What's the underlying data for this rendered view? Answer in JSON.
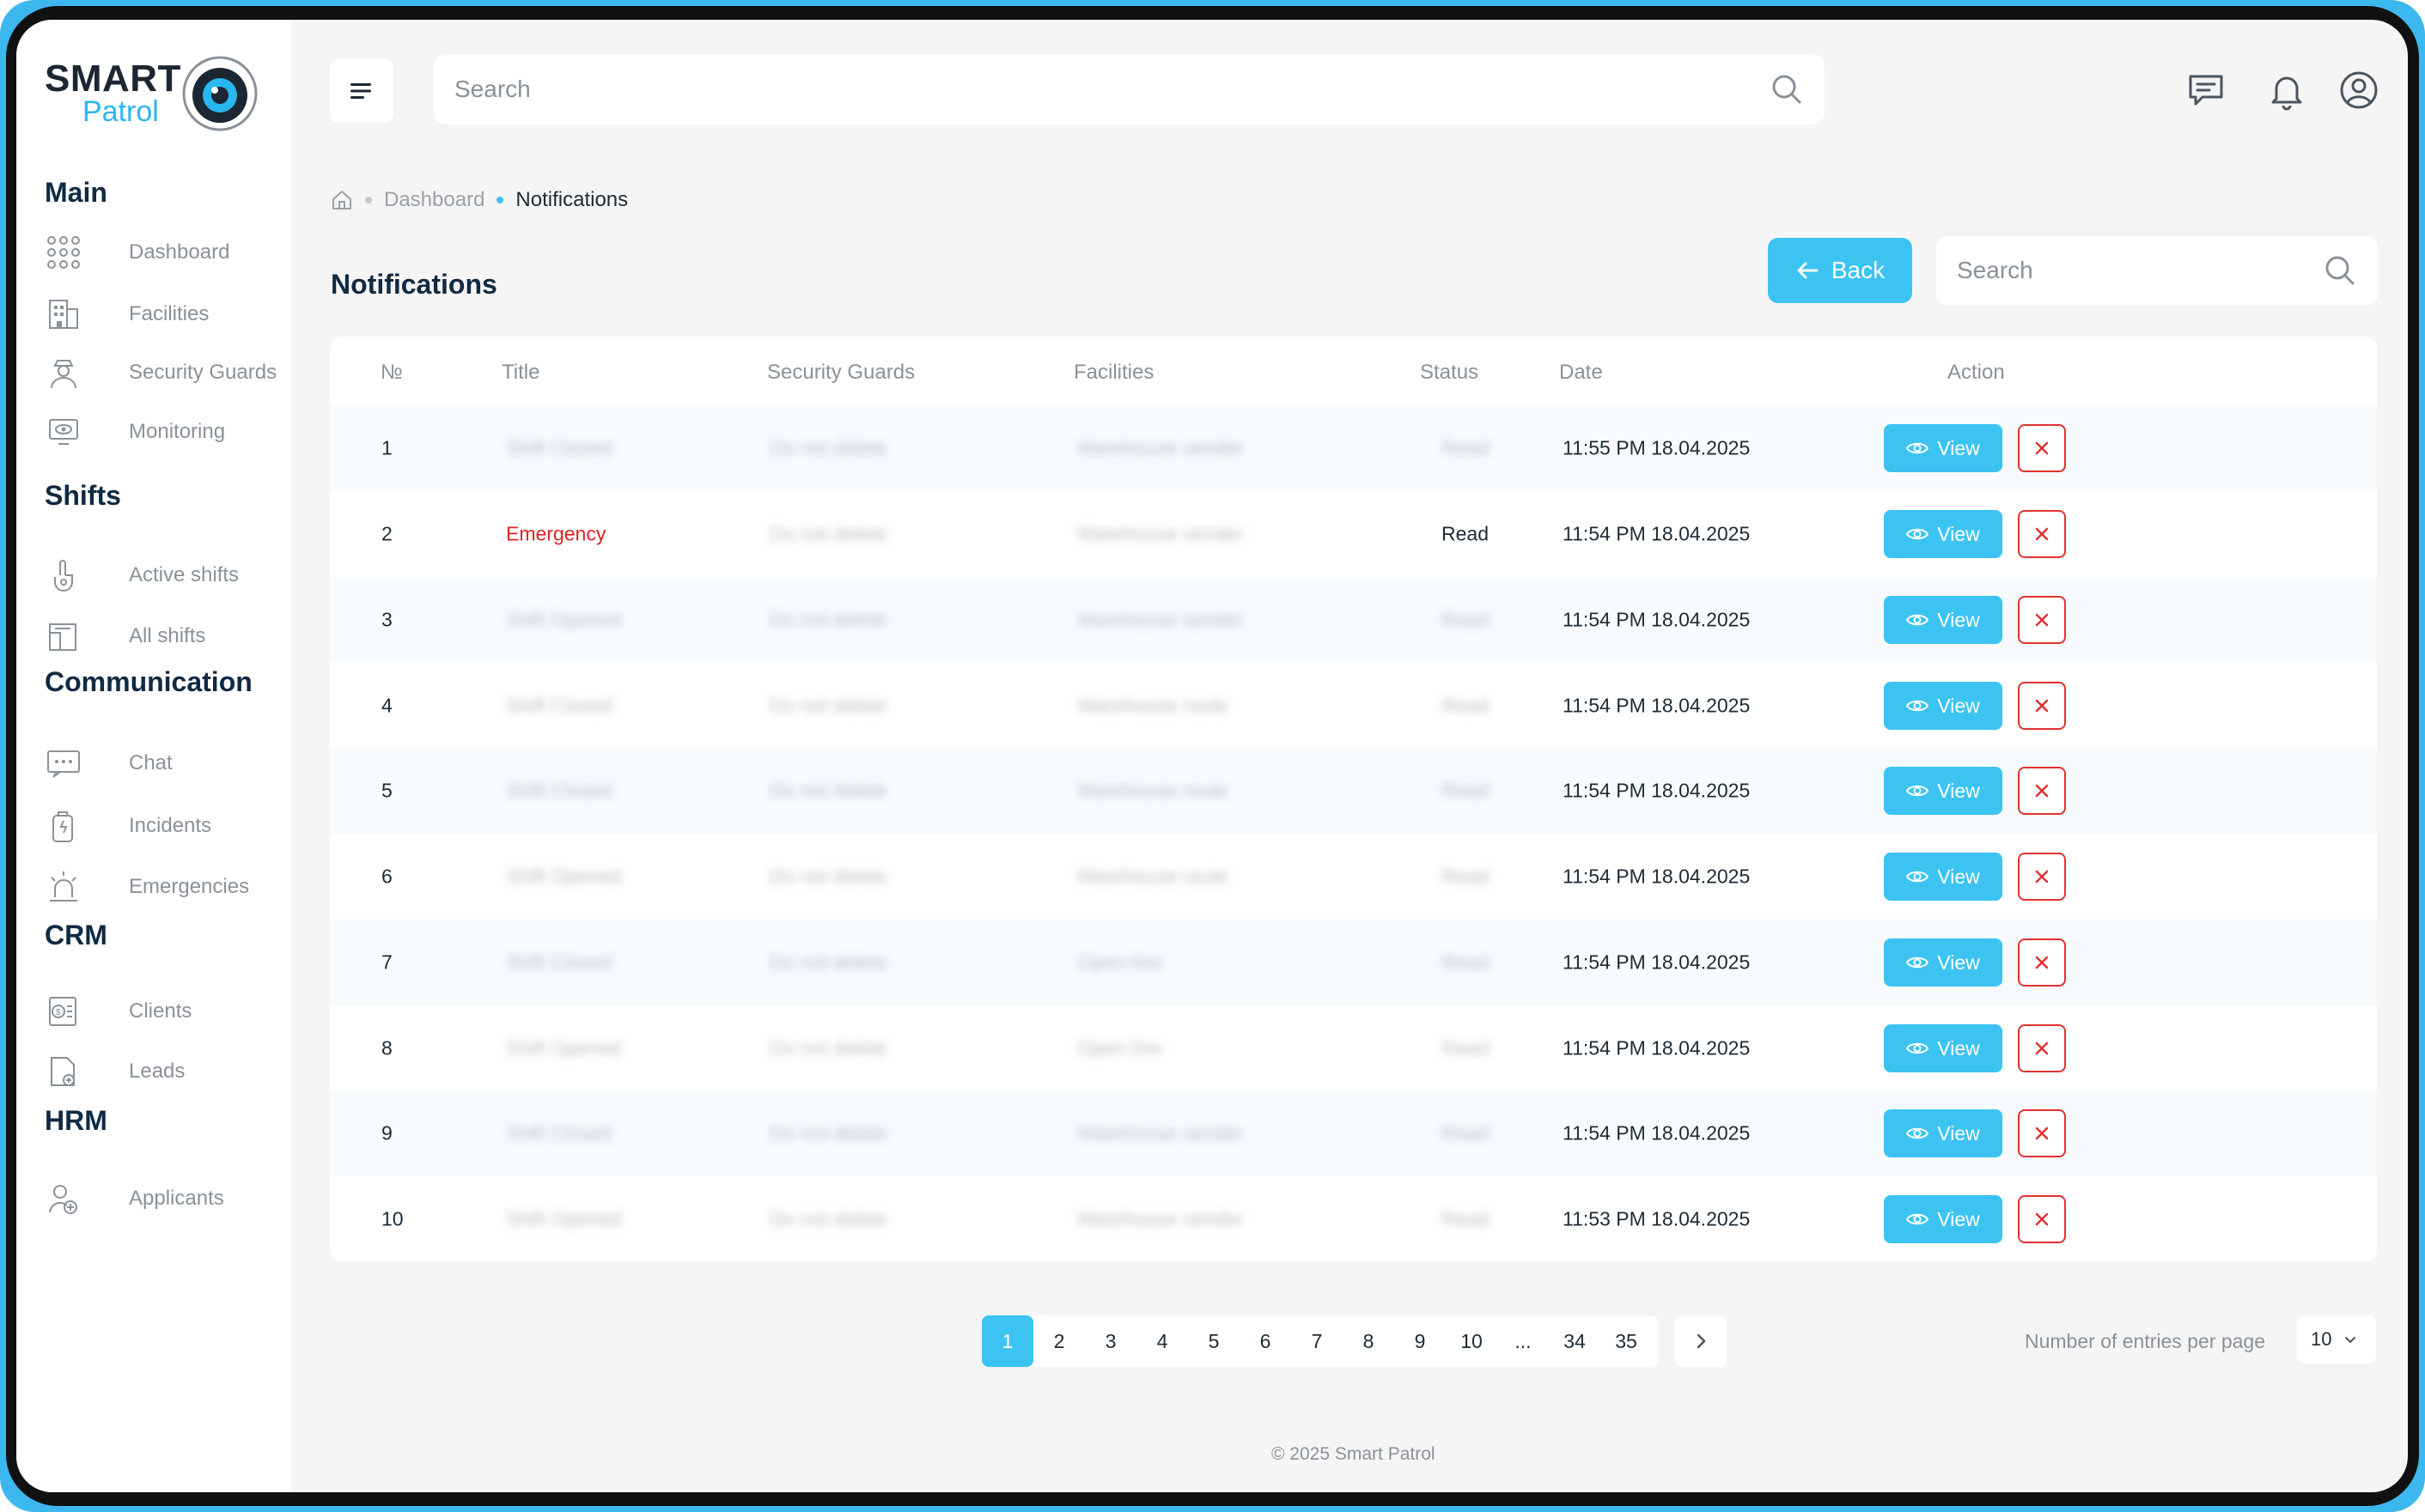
{
  "app": {
    "logo_smart": "SMART",
    "logo_patrol": "Patrol",
    "brand_color": "#3cc3f2"
  },
  "sidebar": {
    "sections": [
      {
        "title": "Main",
        "items": [
          {
            "label": "Dashboard",
            "icon": "dashboard-grid-icon"
          },
          {
            "label": "Facilities",
            "icon": "building-icon"
          },
          {
            "label": "Security Guards",
            "icon": "guard-icon"
          },
          {
            "label": "Monitoring",
            "icon": "monitor-eye-icon"
          }
        ]
      },
      {
        "title": "Shifts",
        "items": [
          {
            "label": "Active shifts",
            "icon": "hand-pointer-icon"
          },
          {
            "label": "All shifts",
            "icon": "folder-icon"
          }
        ]
      },
      {
        "title": "Communication",
        "items": [
          {
            "label": "Chat",
            "icon": "chat-icon"
          },
          {
            "label": "Incidents",
            "icon": "incident-icon"
          },
          {
            "label": "Emergencies",
            "icon": "siren-icon"
          }
        ]
      },
      {
        "title": "CRM",
        "items": [
          {
            "label": "Clients",
            "icon": "money-list-icon"
          },
          {
            "label": "Leads",
            "icon": "document-add-icon"
          }
        ]
      },
      {
        "title": "HRM",
        "items": [
          {
            "label": "Applicants",
            "icon": "user-add-icon"
          }
        ]
      }
    ]
  },
  "topbar": {
    "search_placeholder": "Search",
    "icons": [
      "message-icon",
      "bell-icon",
      "profile-icon"
    ]
  },
  "breadcrumb": {
    "home_icon": "home-icon",
    "items": [
      "Dashboard",
      "Notifications"
    ]
  },
  "page": {
    "title": "Notifications",
    "back_label": "Back",
    "search_placeholder": "Search"
  },
  "table": {
    "columns": [
      "№",
      "Title",
      "Security Guards",
      "Facilities",
      "Status",
      "Date",
      "Action"
    ],
    "view_label": "View",
    "rows": [
      {
        "no": "1",
        "title": "Shift Closed",
        "guard": "Do not delete",
        "facility": "Warehouse sender",
        "status": "Read",
        "date": "11:55 PM 18.04.2025",
        "title_blur": true,
        "status_blur": true
      },
      {
        "no": "2",
        "title": "Emergency",
        "guard": "Do not delete",
        "facility": "Warehouse sender",
        "status": "Read",
        "date": "11:54 PM 18.04.2025",
        "title_blur": false,
        "status_blur": false
      },
      {
        "no": "3",
        "title": "Shift Opened",
        "guard": "Do not delete",
        "facility": "Warehouse sender",
        "status": "Read",
        "date": "11:54 PM 18.04.2025",
        "title_blur": true,
        "status_blur": true
      },
      {
        "no": "4",
        "title": "Shift Closed",
        "guard": "Do not delete",
        "facility": "Warehouse route",
        "status": "Read",
        "date": "11:54 PM 18.04.2025",
        "title_blur": true,
        "status_blur": true
      },
      {
        "no": "5",
        "title": "Shift Closed",
        "guard": "Do not delete",
        "facility": "Warehouse route",
        "status": "Read",
        "date": "11:54 PM 18.04.2025",
        "title_blur": true,
        "status_blur": true
      },
      {
        "no": "6",
        "title": "Shift Opened",
        "guard": "Do not delete",
        "facility": "Warehouse route",
        "status": "Read",
        "date": "11:54 PM 18.04.2025",
        "title_blur": true,
        "status_blur": true
      },
      {
        "no": "7",
        "title": "Shift Closed",
        "guard": "Do not delete",
        "facility": "Open line",
        "status": "Read",
        "date": "11:54 PM 18.04.2025",
        "title_blur": true,
        "status_blur": true
      },
      {
        "no": "8",
        "title": "Shift Opened",
        "guard": "Do not delete",
        "facility": "Open line",
        "status": "Read",
        "date": "11:54 PM 18.04.2025",
        "title_blur": true,
        "status_blur": true
      },
      {
        "no": "9",
        "title": "Shift Closed",
        "guard": "Do not delete",
        "facility": "Warehouse sender",
        "status": "Read",
        "date": "11:54 PM 18.04.2025",
        "title_blur": true,
        "status_blur": true
      },
      {
        "no": "10",
        "title": "Shift Opened",
        "guard": "Do not delete",
        "facility": "Warehouse sender",
        "status": "Read",
        "date": "11:53 PM 18.04.2025",
        "title_blur": true,
        "status_blur": true
      }
    ]
  },
  "pagination": {
    "pages": [
      "1",
      "2",
      "3",
      "4",
      "5",
      "6",
      "7",
      "8",
      "9",
      "10",
      "...",
      "34",
      "35"
    ],
    "current": "1",
    "entries_label": "Number of entries per page",
    "entries_value": "10"
  },
  "footer": "© 2025 Smart Patrol"
}
